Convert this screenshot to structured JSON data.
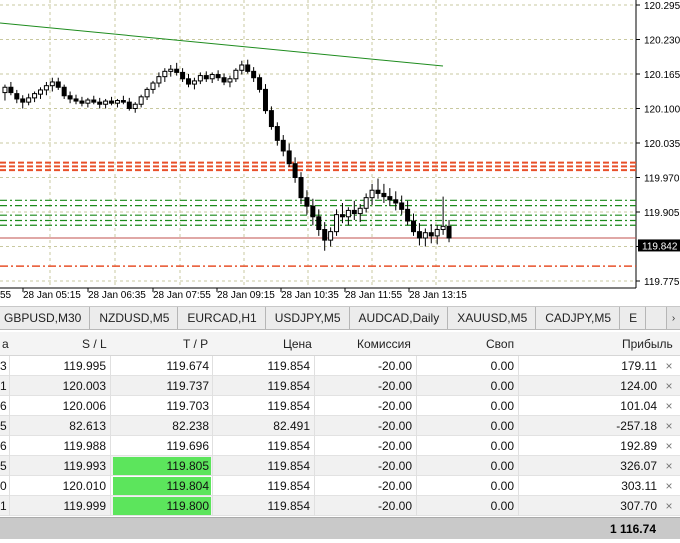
{
  "chart": {
    "price_axis": [
      "120.295",
      "120.230",
      "120.165",
      "120.100",
      "120.035",
      "119.970",
      "119.905",
      "119.840",
      "119.775"
    ],
    "current_price": "119.842",
    "time_axis": [
      "28 Jan 05:15",
      "28 Jan 06:35",
      "28 Jan 07:55",
      "28 Jan 09:15",
      "28 Jan 10:35",
      "28 Jan 11:55",
      "28 Jan 13:15"
    ],
    "time_axis_left_partial": "55",
    "colors": {
      "background": "#ffffff",
      "grid": "#c9c9a0",
      "candle": "#000000",
      "trendline": "#1e8c1e",
      "tp_lines": "#1a8a1a",
      "sl_lines": "#e8502a",
      "price_line": "#c0504d",
      "price_label_bg": "#000000"
    }
  },
  "tabs": [
    {
      "label": "GBPUSD,M30"
    },
    {
      "label": "NZDUSD,M5"
    },
    {
      "label": "EURCAD,H1"
    },
    {
      "label": "USDJPY,M5"
    },
    {
      "label": "AUDCAD,Daily"
    },
    {
      "label": "XAUUSD,M5"
    },
    {
      "label": "CADJPY,M5"
    },
    {
      "label": "E"
    }
  ],
  "tab_scroll_icon": "chevron-right-icon",
  "table": {
    "columns": {
      "first_partial": "а",
      "sl": "S / L",
      "tp": "T / P",
      "price": "Цена",
      "commission": "Комиссия",
      "swap": "Своп",
      "profit": "Прибыль"
    },
    "rows": [
      {
        "first": "3",
        "sl": "119.995",
        "tp": "119.674",
        "price": "119.854",
        "commission": "-20.00",
        "swap": "0.00",
        "profit": "179.11",
        "tp_highlight": false
      },
      {
        "first": "1",
        "sl": "120.003",
        "tp": "119.737",
        "price": "119.854",
        "commission": "-20.00",
        "swap": "0.00",
        "profit": "124.00",
        "tp_highlight": false
      },
      {
        "first": "6",
        "sl": "120.006",
        "tp": "119.703",
        "price": "119.854",
        "commission": "-20.00",
        "swap": "0.00",
        "profit": "101.04",
        "tp_highlight": false
      },
      {
        "first": "5",
        "sl": "82.613",
        "tp": "82.238",
        "price": "82.491",
        "commission": "-20.00",
        "swap": "0.00",
        "profit": "-257.18",
        "tp_highlight": false
      },
      {
        "first": "6",
        "sl": "119.988",
        "tp": "119.696",
        "price": "119.854",
        "commission": "-20.00",
        "swap": "0.00",
        "profit": "192.89",
        "tp_highlight": false
      },
      {
        "first": "5",
        "sl": "119.993",
        "tp": "119.805",
        "price": "119.854",
        "commission": "-20.00",
        "swap": "0.00",
        "profit": "326.07",
        "tp_highlight": true
      },
      {
        "first": "0",
        "sl": "120.010",
        "tp": "119.804",
        "price": "119.854",
        "commission": "-20.00",
        "swap": "0.00",
        "profit": "303.11",
        "tp_highlight": true
      },
      {
        "first": "1",
        "sl": "119.999",
        "tp": "119.800",
        "price": "119.854",
        "commission": "-20.00",
        "swap": "0.00",
        "profit": "307.70",
        "tp_highlight": true
      }
    ],
    "close_icon": "close-icon",
    "close_glyph": "×",
    "total": "1 116.74"
  }
}
